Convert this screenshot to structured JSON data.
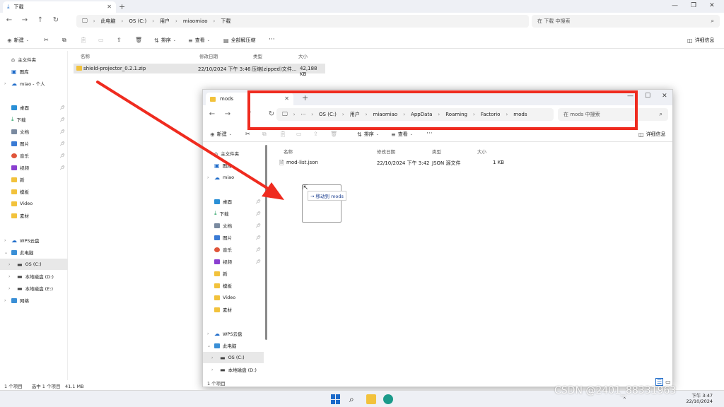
{
  "back_window": {
    "tab_title": "下载",
    "address": [
      "此电脑",
      "OS (C:)",
      "用户",
      "miaomiao",
      "下载"
    ],
    "search_placeholder": "在 下载 中搜索",
    "toolbar": {
      "new": "新建",
      "sort": "排序",
      "view": "查看",
      "extract_all": "全部解压缩",
      "more": "···",
      "details": "详细信息"
    },
    "sidebar": [
      {
        "label": "主文件夹",
        "icon": "home-icon"
      },
      {
        "label": "图库",
        "icon": "gallery-icon"
      },
      {
        "label": "miao - 个人",
        "icon": "cloud-icon"
      },
      {
        "label": "桌面",
        "icon": "desktop-icon"
      },
      {
        "label": "下载",
        "icon": "download-icon"
      },
      {
        "label": "文档",
        "icon": "document-icon"
      },
      {
        "label": "图片",
        "icon": "picture-icon"
      },
      {
        "label": "音乐",
        "icon": "music-icon"
      },
      {
        "label": "视频",
        "icon": "video-icon"
      },
      {
        "label": "新",
        "icon": "folder-icon"
      },
      {
        "label": "模板",
        "icon": "folder-icon"
      },
      {
        "label": "Video",
        "icon": "folder-icon"
      },
      {
        "label": "素材",
        "icon": "folder-icon"
      },
      {
        "label": "WPS云盘",
        "icon": "cloud-icon"
      },
      {
        "label": "此电脑",
        "icon": "pc-icon"
      },
      {
        "label": "OS (C:)",
        "icon": "drive-icon"
      },
      {
        "label": "本地磁盘 (D:)",
        "icon": "drive-icon"
      },
      {
        "label": "本地磁盘 (E:)",
        "icon": "drive-icon"
      },
      {
        "label": "网络",
        "icon": "network-icon"
      }
    ],
    "columns": [
      "名称",
      "修改日期",
      "类型",
      "大小"
    ],
    "files": [
      {
        "name": "shield-projector_0.2.1.zip",
        "date": "22/10/2024 下午 3:46",
        "type": "压缩(zipped)文件...",
        "size": "42,188 KB"
      }
    ],
    "status": "1 个项目　　选中 1 个项目　41.1 MB"
  },
  "front_window": {
    "tab_title": "mods",
    "address": [
      "OS (C:)",
      "用户",
      "miaomiao",
      "AppData",
      "Roaming",
      "Factorio",
      "mods"
    ],
    "search_placeholder": "在 mods 中搜索",
    "toolbar": {
      "new": "新建",
      "sort": "排序",
      "view": "查看",
      "more": "···",
      "details": "详细信息"
    },
    "sidebar": [
      {
        "label": "主文件夹"
      },
      {
        "label": "图库"
      },
      {
        "label": "miao"
      },
      {
        "label": "桌面"
      },
      {
        "label": "下载"
      },
      {
        "label": "文档"
      },
      {
        "label": "图片"
      },
      {
        "label": "音乐"
      },
      {
        "label": "视频"
      },
      {
        "label": "新"
      },
      {
        "label": "模板"
      },
      {
        "label": "Video"
      },
      {
        "label": "素材"
      },
      {
        "label": "WPS云盘"
      },
      {
        "label": "此电脑"
      },
      {
        "label": "OS (C:)"
      },
      {
        "label": "本地磁盘 (D:)"
      }
    ],
    "columns": [
      "名称",
      "修改日期",
      "类型",
      "大小"
    ],
    "files": [
      {
        "name": "mod-list.json",
        "date": "22/10/2024 下午 3:42",
        "type": "JSON 源文件",
        "size": "1 KB"
      }
    ],
    "drag_tooltip": "→ 移动到 mods",
    "status": "1 个项目"
  },
  "taskbar": {
    "time": "下午 3:47",
    "date": "22/10/2024"
  },
  "watermark": "CSDN @2401_88331963",
  "colors": {
    "highlight": "#ef2b1f",
    "accent": "#1c6ac9"
  }
}
